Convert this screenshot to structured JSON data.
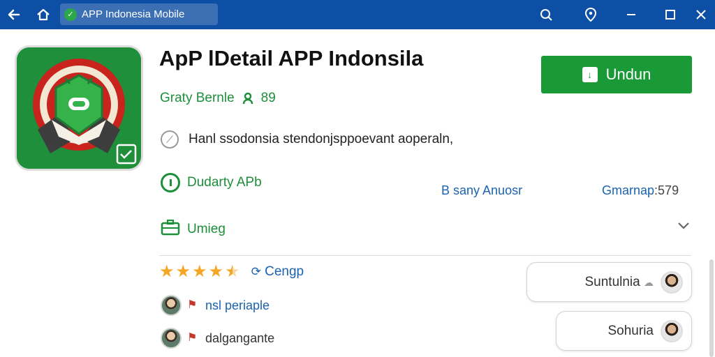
{
  "browser": {
    "url_text": "APP Indonesia Mobile"
  },
  "app": {
    "title": "ApP lDetail APP Indonsila",
    "developer": "Graty Bernle",
    "developer_score": "89",
    "description": "Hanl ssodonsia stendonjsppoevant aoperaln,",
    "download_label": "Undun",
    "brand_color": "#1a9a37"
  },
  "details": {
    "row1_label": "Dudarty APb",
    "row2_label": "Umieg",
    "info_left": "B sany Anuosr",
    "info_right_label": "Gmarnap",
    "info_right_value": ":579"
  },
  "reviews": {
    "rating_label": "Cengp",
    "stars": 4.5,
    "items": [
      {
        "name": "nsl periaple",
        "icon": "flag-icon"
      },
      {
        "name": "dalgangante",
        "icon": "flag-icon"
      }
    ],
    "pill1_label": "Suntulnia",
    "pill2_label": "Sohuria"
  }
}
